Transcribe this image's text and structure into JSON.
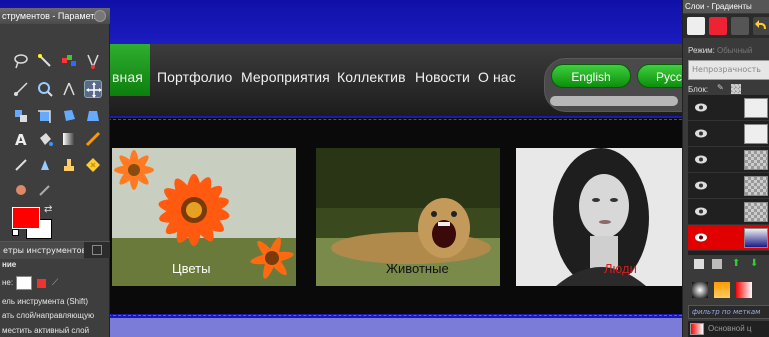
{
  "canvas": {
    "nav": {
      "active_item": "вная",
      "items": [
        "Портфолио",
        "Мероприятия",
        "Коллектив",
        "Новости",
        "О нас"
      ],
      "lang_english": "English",
      "lang_russian": "Русс"
    },
    "gallery": {
      "items": [
        {
          "caption": "Цветы",
          "caption_color": "#ffffff"
        },
        {
          "caption": "Животные",
          "caption_color": "#111111"
        },
        {
          "caption": "Люди",
          "caption_color": "#cc2222"
        }
      ]
    }
  },
  "toolbox": {
    "title": "струментов - Парамет...",
    "tab_options_label": "етры инструментов",
    "options": {
      "section": "ние",
      "mode_label": "не:",
      "line1": "ель инструмента  (Shift)",
      "line2": "ать слой/направляющую",
      "line3": "местить активный слой"
    },
    "colors": {
      "foreground": "#ff0000",
      "background": "#ffffff"
    }
  },
  "layers_panel": {
    "title": "Слои - Градиенты",
    "mode_label": "Режим:",
    "mode_value": "Обычный",
    "opacity_label": "Непрозрачность",
    "lock_label": "Блок:",
    "filter_label": "фильтр по меткам",
    "last_layer_label": "Основной ц",
    "layer_count": 6,
    "selected_layer_index": 5
  }
}
